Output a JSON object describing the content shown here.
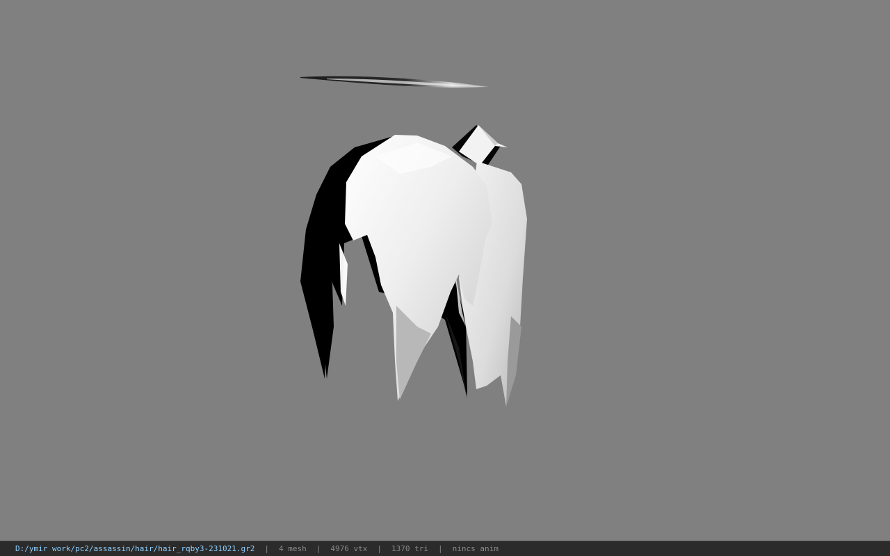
{
  "viewport": {
    "background_color": "#808080",
    "model_name": "hair_rqby3"
  },
  "status_bar": {
    "file_path": "D:/ymir work/pc2/assassin/hair/hair_rqby3-231021.gr2",
    "separator": "|",
    "mesh_count": "4 mesh",
    "vertex_count": "4976 vtx",
    "triangle_count": "1370 tri",
    "anim_status": "nincs anim",
    "path_color": "#8fd0ff",
    "text_color": "#8a8a8a"
  }
}
